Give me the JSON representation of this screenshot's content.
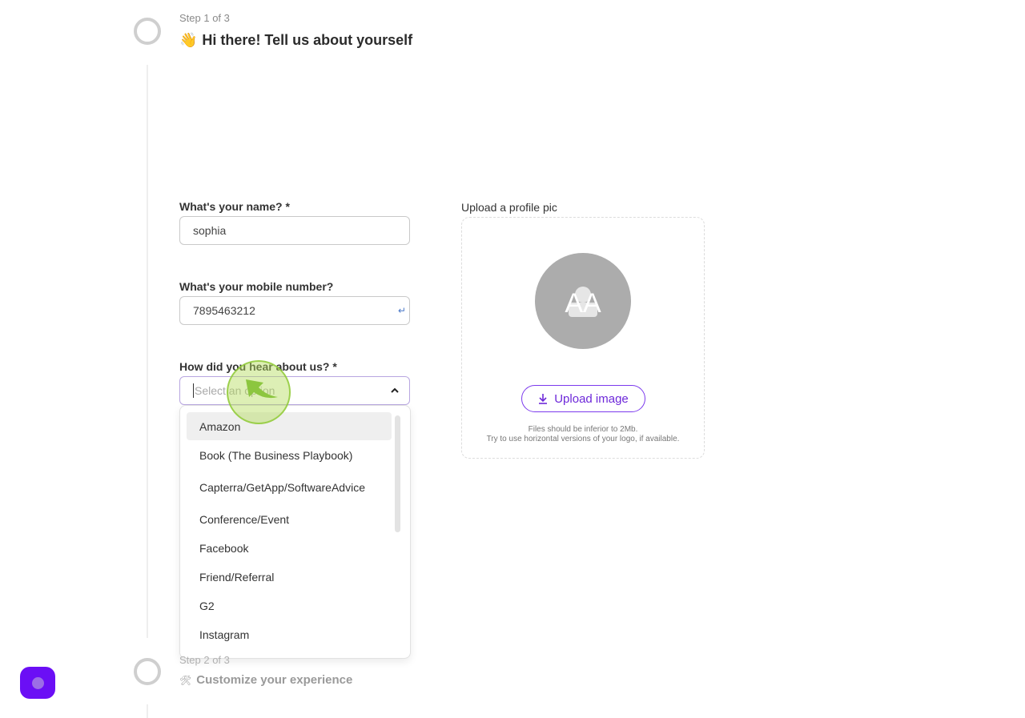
{
  "steps": [
    {
      "kicker": "Step 1 of 3",
      "emoji": "👋",
      "title": "Hi there! Tell us about yourself"
    },
    {
      "kicker": "Step 2 of 3",
      "emoji": "🛠",
      "title": "Customize your experience"
    }
  ],
  "form": {
    "name": {
      "label": "What's your name? *",
      "value": "sophia"
    },
    "mobile": {
      "label": "What's your mobile number?",
      "value": "7895463212",
      "enter_icon": "↵"
    },
    "source": {
      "label": "How did you hear about us? *",
      "placeholder": "Select an option",
      "expanded": true,
      "options": [
        "Amazon",
        "Book (The Business Playbook)",
        "Capterra/GetApp/SoftwareAdvice",
        "Conference/Event",
        "Facebook",
        "Friend/Referral",
        "G2",
        "Instagram"
      ],
      "highlighted_index": 0
    }
  },
  "upload": {
    "label": "Upload a profile pic",
    "button_label": "Upload image",
    "hint_line1": "Files should be inferior to 2Mb.",
    "hint_line2": "Try to use horizontal versions of your logo, if available."
  },
  "colors": {
    "accent": "#7c3aed",
    "fab": "#6b0ff5",
    "cursor_highlight": "#a3d94a"
  }
}
